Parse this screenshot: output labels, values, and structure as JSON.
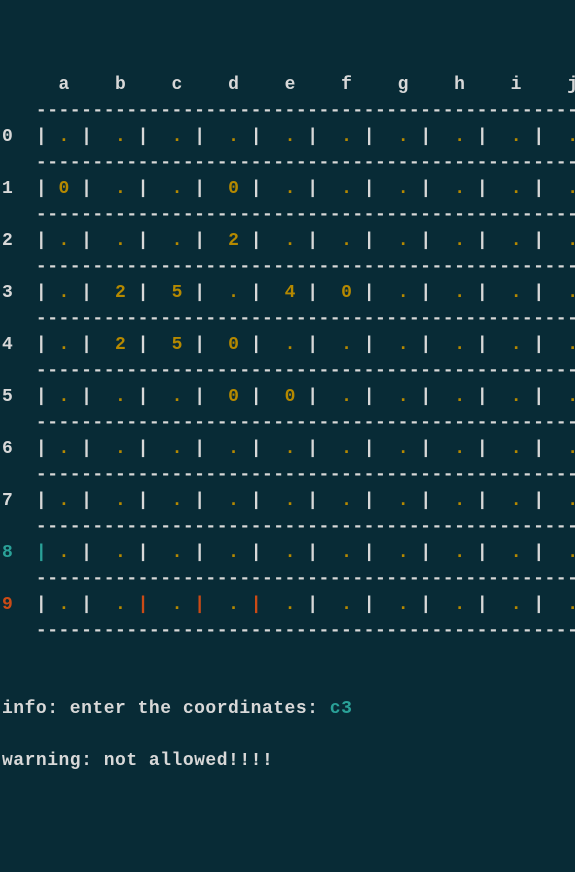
{
  "grid": {
    "columns": [
      "a",
      "b",
      "c",
      "d",
      "e",
      "f",
      "g",
      "h",
      "i",
      "j"
    ],
    "row_labels": [
      "0",
      "1",
      "2",
      "3",
      "4",
      "5",
      "6",
      "7",
      "8",
      "9"
    ],
    "row_label_styles": [
      "rownum",
      "rownum",
      "rownum",
      "rownum",
      "rownum",
      "rownum",
      "rownum",
      "rownum",
      "rownum-teal",
      "rownum-red"
    ],
    "row_first_pipe_styles": [
      "pipe",
      "pipe",
      "pipe",
      "pipe",
      "pipe",
      "pipe",
      "pipe",
      "pipe",
      "pipe-teal",
      "pipe"
    ],
    "rows": [
      [
        ".",
        ".",
        ".",
        ".",
        ".",
        ".",
        ".",
        ".",
        ".",
        "."
      ],
      [
        "0",
        ".",
        ".",
        "0",
        ".",
        ".",
        ".",
        ".",
        ".",
        "."
      ],
      [
        ".",
        ".",
        ".",
        "2",
        ".",
        ".",
        ".",
        ".",
        ".",
        "."
      ],
      [
        ".",
        "2",
        "5",
        ".",
        "4",
        "0",
        ".",
        ".",
        ".",
        "."
      ],
      [
        ".",
        "2",
        "5",
        "0",
        ".",
        ".",
        ".",
        ".",
        ".",
        "."
      ],
      [
        ".",
        ".",
        ".",
        "0",
        "0",
        ".",
        ".",
        ".",
        ".",
        "."
      ],
      [
        ".",
        ".",
        ".",
        ".",
        ".",
        ".",
        ".",
        ".",
        ".",
        "."
      ],
      [
        ".",
        ".",
        ".",
        ".",
        ".",
        ".",
        ".",
        ".",
        ".",
        "."
      ],
      [
        ".",
        ".",
        ".",
        ".",
        ".",
        ".",
        ".",
        ".",
        ".",
        "."
      ],
      [
        ".",
        ".",
        ".",
        ".",
        ".",
        ".",
        ".",
        ".",
        ".",
        "."
      ]
    ],
    "row9_pipe_styles": [
      "pipe",
      "pipe",
      "pipe-red",
      "pipe-red",
      "pipe-red",
      "pipe",
      "pipe",
      "pipe",
      "pipe",
      "pipe",
      "pipe"
    ],
    "dash_segment": "-----------------------------------------------------------"
  },
  "messages": {
    "info_label": "info: enter the coordinates: ",
    "info_value": "c3",
    "warning": "warning: not allowed!!!!"
  }
}
